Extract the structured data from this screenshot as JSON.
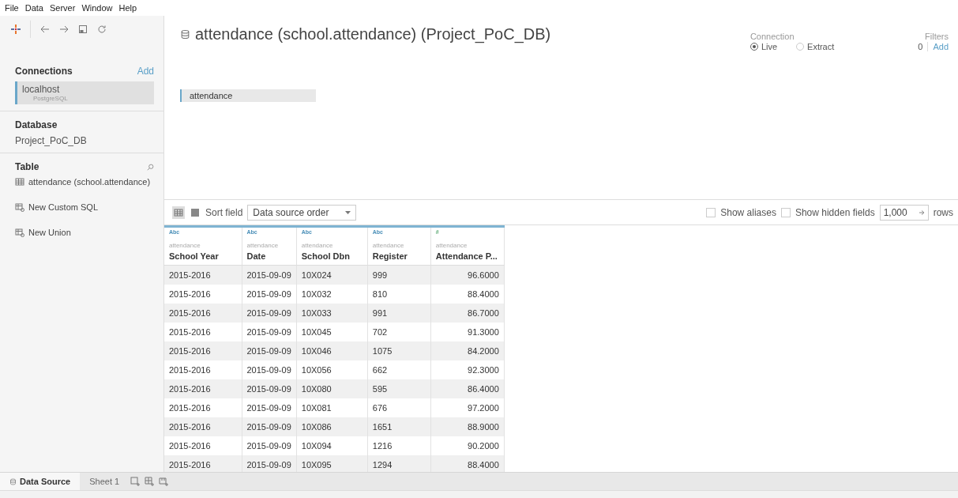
{
  "menu": [
    "File",
    "Data",
    "Server",
    "Window",
    "Help"
  ],
  "connections": {
    "title": "Connections",
    "add": "Add",
    "items": [
      {
        "name": "localhost",
        "type": "PostgreSQL",
        "selected": true
      }
    ]
  },
  "database": {
    "title": "Database",
    "value": "Project_PoC_DB"
  },
  "table_section": {
    "title": "Table",
    "items": [
      {
        "kind": "table",
        "label": "attendance (school.attendance)"
      },
      {
        "kind": "sql",
        "label": "New Custom SQL"
      },
      {
        "kind": "sql",
        "label": "New Union"
      }
    ]
  },
  "title": "attendance (school.attendance) (Project_PoC_DB)",
  "connection": {
    "label": "Connection",
    "options": [
      {
        "label": "Live",
        "selected": true
      },
      {
        "label": "Extract",
        "selected": false
      }
    ]
  },
  "filters": {
    "label": "Filters",
    "count": "0",
    "add": "Add"
  },
  "canvas_table": "attendance",
  "toolbar": {
    "sort_label": "Sort field",
    "sort_value": "Data source order",
    "show_aliases": {
      "label": "Show aliases",
      "checked": false
    },
    "show_hidden": {
      "label": "Show hidden fields",
      "checked": false
    },
    "rows_value": "1,000",
    "rows_label": "rows"
  },
  "columns": [
    {
      "type": "Abc",
      "source": "attendance",
      "name": "School Year",
      "numeric": false
    },
    {
      "type": "Abc",
      "source": "attendance",
      "name": "Date",
      "numeric": false
    },
    {
      "type": "Abc",
      "source": "attendance",
      "name": "School Dbn",
      "numeric": false
    },
    {
      "type": "Abc",
      "source": "attendance",
      "name": "Register",
      "numeric": false
    },
    {
      "type": "#",
      "source": "attendance",
      "name": "Attendance P...",
      "numeric": true
    }
  ],
  "rows": [
    [
      "2015-2016",
      "2015-09-09",
      "10X024",
      "999",
      "96.6000"
    ],
    [
      "2015-2016",
      "2015-09-09",
      "10X032",
      "810",
      "88.4000"
    ],
    [
      "2015-2016",
      "2015-09-09",
      "10X033",
      "991",
      "86.7000"
    ],
    [
      "2015-2016",
      "2015-09-09",
      "10X045",
      "702",
      "91.3000"
    ],
    [
      "2015-2016",
      "2015-09-09",
      "10X046",
      "1075",
      "84.2000"
    ],
    [
      "2015-2016",
      "2015-09-09",
      "10X056",
      "662",
      "92.3000"
    ],
    [
      "2015-2016",
      "2015-09-09",
      "10X080",
      "595",
      "86.4000"
    ],
    [
      "2015-2016",
      "2015-09-09",
      "10X081",
      "676",
      "97.2000"
    ],
    [
      "2015-2016",
      "2015-09-09",
      "10X086",
      "1651",
      "88.9000"
    ],
    [
      "2015-2016",
      "2015-09-09",
      "10X094",
      "1216",
      "90.2000"
    ],
    [
      "2015-2016",
      "2015-09-09",
      "10X095",
      "1294",
      "88.4000"
    ]
  ],
  "sheet_tabs": [
    {
      "label": "Data Source",
      "selected": true
    },
    {
      "label": "Sheet 1",
      "selected": false
    }
  ]
}
